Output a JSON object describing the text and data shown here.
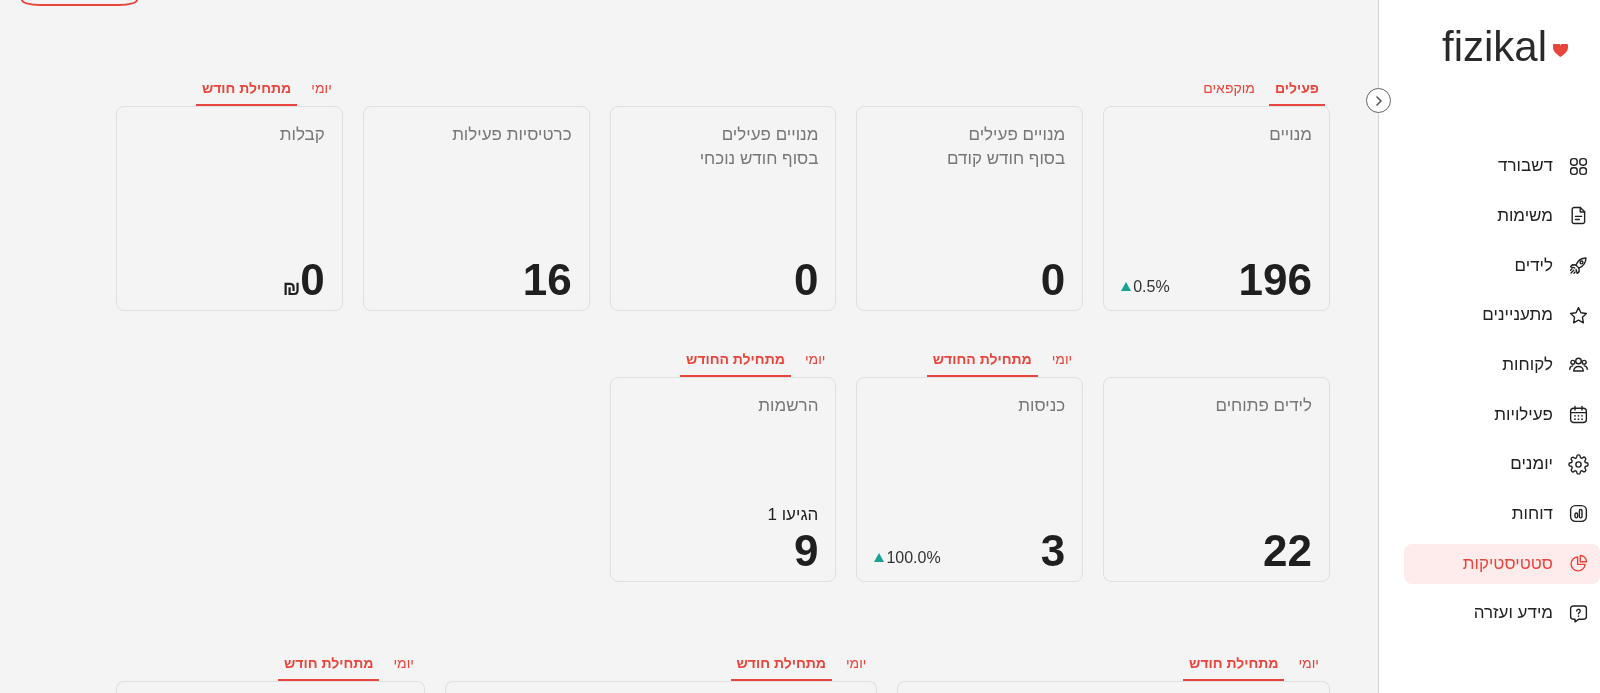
{
  "header": {
    "buttons": [
      {
        "kind": "outline"
      }
    ]
  },
  "sidebar": {
    "logo": "fizikal",
    "items": [
      {
        "label": "דשבורד",
        "selected": false
      },
      {
        "label": "משימות",
        "selected": false
      },
      {
        "label": "לידים",
        "selected": false
      },
      {
        "label": "מתעניינים",
        "selected": false
      },
      {
        "label": "לקוחות",
        "selected": false
      },
      {
        "label": "פעילויות",
        "selected": false
      },
      {
        "label": "יומנים",
        "selected": false
      },
      {
        "label": "דוחות",
        "selected": false
      },
      {
        "label": "סטטיסטיקות",
        "selected": true
      },
      {
        "label": "מידע ועזרה",
        "selected": false
      }
    ]
  },
  "sections": [
    {
      "cards": [
        {
          "tabs": [
            {
              "label": "פעילים",
              "selected": true
            },
            {
              "label": "מוקפאים",
              "selected": false
            }
          ],
          "title": "מנויים",
          "value": "196",
          "change": {
            "up": true,
            "text": "0.5%"
          }
        },
        {
          "title": "מנויים פעילים\nבסוף חודש קודם",
          "value": "0"
        },
        {
          "title": "מנויים פעילים\nבסוף חודש נוכחי",
          "value": "0"
        },
        {
          "title": "כרטיסיות פעילות",
          "value": "16"
        },
        {
          "tabs": [
            {
              "label": "יומי",
              "selected": false
            },
            {
              "label": "מתחילת חודש",
              "selected": true
            }
          ],
          "title": "קבלות",
          "value": "0",
          "unit": "₪"
        }
      ]
    },
    {
      "cards": [
        {
          "title": "לידים פתוחים",
          "value": "22"
        },
        {
          "tabs": [
            {
              "label": "יומי",
              "selected": false
            },
            {
              "label": "מתחילת החודש",
              "selected": true
            }
          ],
          "title": "כניסות",
          "value": "3",
          "change": {
            "up": true,
            "text": "100.0%"
          }
        },
        {
          "tabs": [
            {
              "label": "יומי",
              "selected": false
            },
            {
              "label": "מתחילת החודש",
              "selected": true
            }
          ],
          "title": "הרשמות",
          "note": "הגיעו 1",
          "value": "9"
        }
      ]
    },
    {
      "cards": [
        {
          "tabs": [
            {
              "label": "יומי",
              "selected": false
            },
            {
              "label": "מתחילת חודש",
              "selected": true
            }
          ]
        },
        {
          "tabs": [
            {
              "label": "יומי",
              "selected": false
            },
            {
              "label": "מתחילת חודש",
              "selected": true
            }
          ]
        },
        {
          "tabs": [
            {
              "label": "יומי",
              "selected": false
            },
            {
              "label": "מתחילת חודש",
              "selected": true
            }
          ]
        }
      ]
    }
  ]
}
